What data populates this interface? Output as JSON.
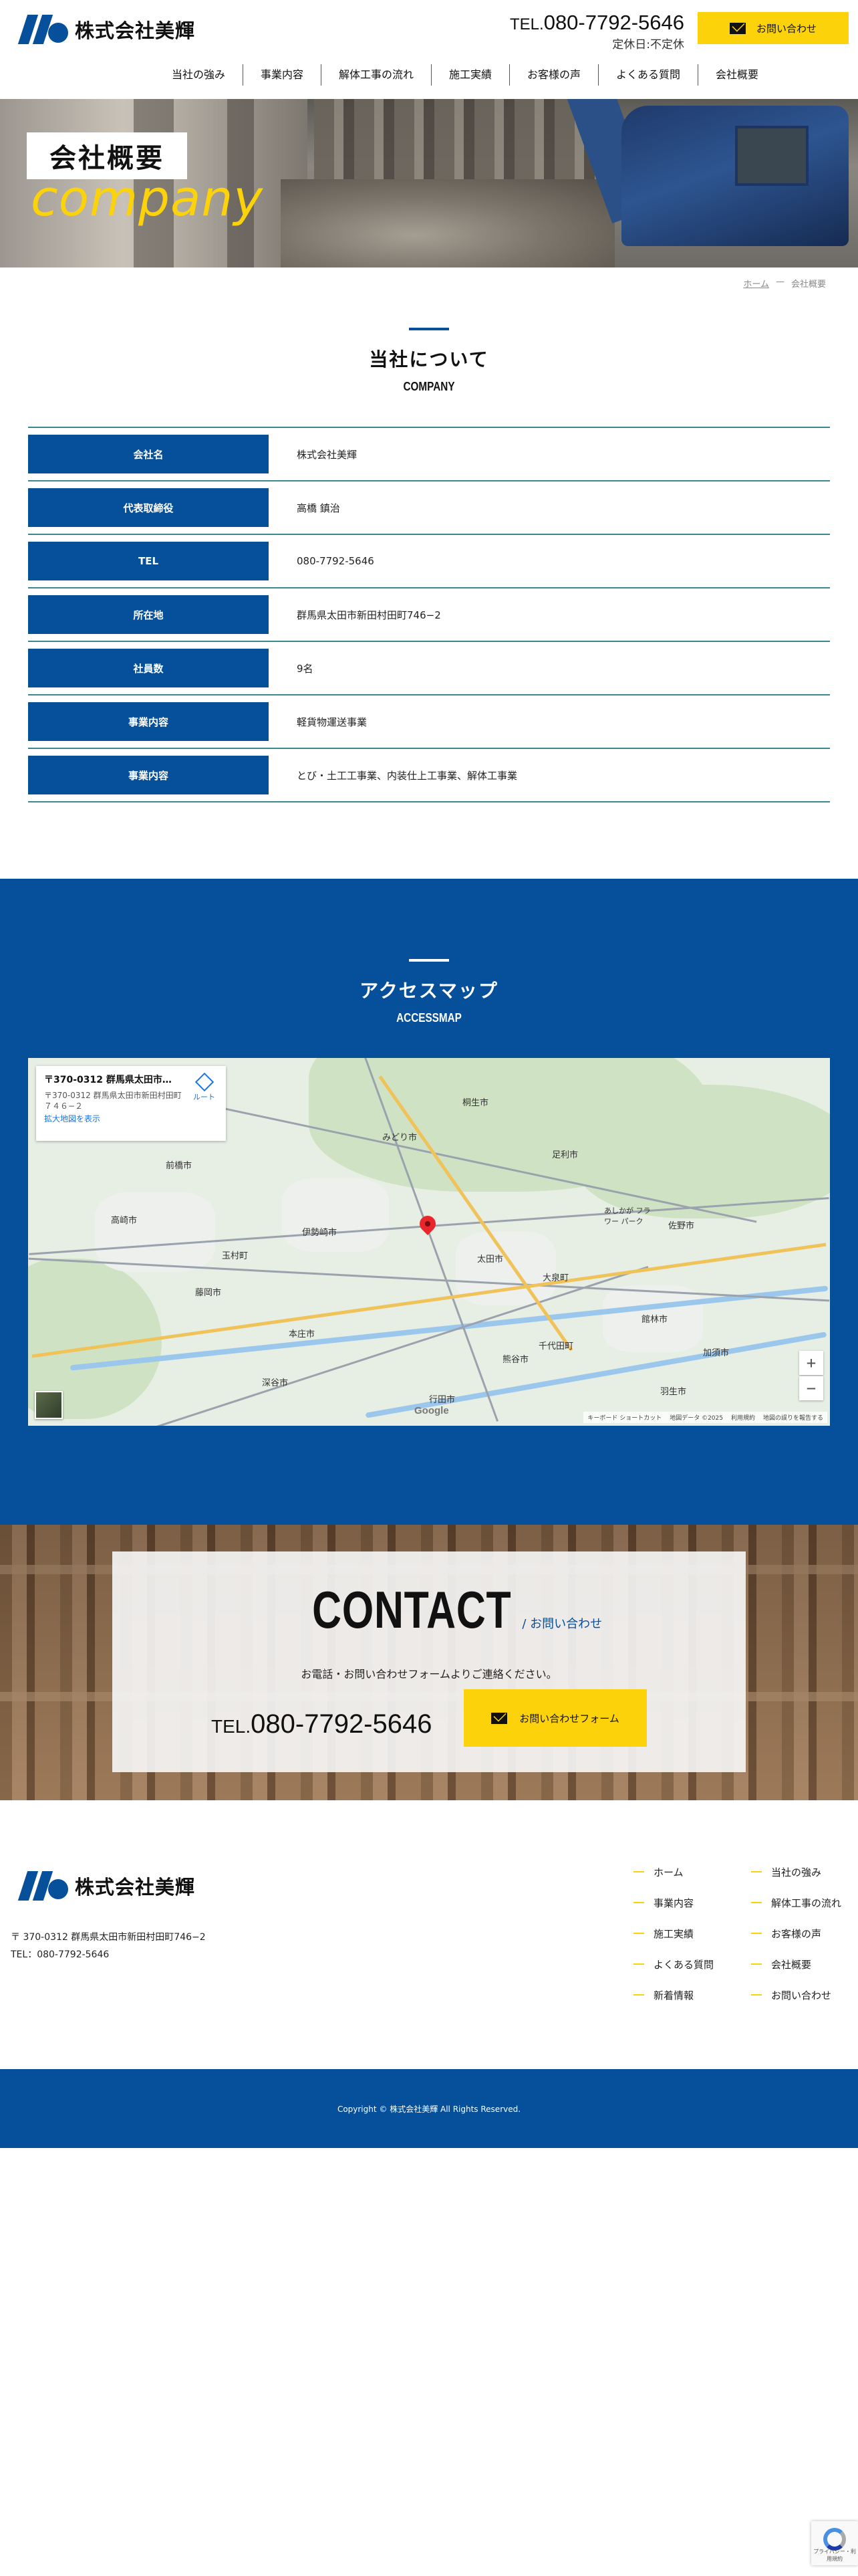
{
  "header": {
    "logo_text": "株式会社美輝",
    "tel_prefix": "TEL.",
    "tel_number": "080-7792-5646",
    "hours": "定休日:不定休",
    "cta_label": "お問い合わせ"
  },
  "nav": [
    "当社の強み",
    "事業内容",
    "解体工事の流れ",
    "施工実績",
    "お客様の声",
    "よくある質問",
    "会社概要"
  ],
  "hero": {
    "title": "会社概要",
    "subtitle": "company"
  },
  "breadcrumb": {
    "home": "ホーム",
    "separator": "—",
    "current": "会社概要"
  },
  "company": {
    "title_jp": "当社について",
    "title_en": "COMPANY",
    "rows": [
      {
        "label": "会社名",
        "value": "株式会社美輝"
      },
      {
        "label": "代表取締役",
        "value": "高橋 鎮治"
      },
      {
        "label": "TEL",
        "value": "080-7792-5646"
      },
      {
        "label": "所在地",
        "value": "群馬県太田市新田村田町746−2"
      },
      {
        "label": "社員数",
        "value": "9名"
      },
      {
        "label": "事業内容",
        "value": "軽貨物運送事業"
      },
      {
        "label": "事業内容",
        "value": "とび・土工工事業、内装仕上工事業、解体工事業"
      }
    ]
  },
  "access": {
    "title_jp": "アクセスマップ",
    "title_en": "ACCESSMAP",
    "map": {
      "card_title": "〒370-0312 群馬県太田市新田村田町…",
      "card_address": "〒370-0312 群馬県太田市新田村田町７４６−２",
      "route_label": "ルート",
      "enlarge_link": "拡大地図を表示",
      "zoom_in": "+",
      "zoom_out": "−",
      "google": "Google",
      "attrib": [
        "キーボード ショートカット",
        "地図データ ©2025",
        "利用規約",
        "地図の誤りを報告する"
      ],
      "place_labels": [
        "高崎市",
        "伊勢崎市",
        "みどり市",
        "足利市",
        "あしかが フラワー パーク",
        "前橋市",
        "太田市",
        "熊谷市",
        "深谷市",
        "館林市",
        "桐生市",
        "佐野市",
        "本庄市",
        "玉村町",
        "藤岡市",
        "大泉町",
        "千代田町",
        "羽生市",
        "行田市",
        "加須市"
      ]
    }
  },
  "contact": {
    "title_en": "CONTACT",
    "title_jp": "/ お問い合わせ",
    "description": "お電話・お問い合わせフォームよりご連絡ください。",
    "tel_prefix": "TEL.",
    "tel_number": "080-7792-5646",
    "form_button": "お問い合わせフォーム"
  },
  "footer": {
    "logo_text": "株式会社美輝",
    "address": "〒 370-0312 群馬県太田市新田村田町746−2",
    "tel": "TEL：080-7792-5646",
    "links": [
      "ホーム",
      "当社の強み",
      "事業内容",
      "解体工事の流れ",
      "施工実績",
      "お客様の声",
      "よくある質問",
      "会社概要",
      "新着情報",
      "お問い合わせ"
    ],
    "copyright": "Copyright © 株式会社美輝 All Rights Reserved."
  },
  "recaptcha": {
    "text": "プライバシー・利用規約"
  },
  "colors": {
    "brand_blue": "#06509b",
    "accent_yellow": "#fcd20a",
    "table_line": "#3b8a8f"
  }
}
